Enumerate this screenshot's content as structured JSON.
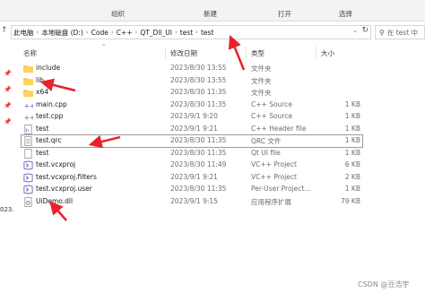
{
  "ribbon": {
    "groups": [
      "组织",
      "新建",
      "打开",
      "选择"
    ]
  },
  "address": {
    "path": [
      "此电脑",
      "本地磁盘 (D:)",
      "Code",
      "C++",
      "QT_Dll_UI",
      "test",
      "test"
    ],
    "search_placeholder": "在 test 中"
  },
  "navpane": {
    "label": "023."
  },
  "columns": {
    "name": "名称",
    "date": "修改日期",
    "type": "类型",
    "size": "大小"
  },
  "files": [
    {
      "name": "include",
      "date": "2023/8/30 13:55",
      "type": "文件夹",
      "size": "",
      "icon": "folder-icon",
      "selected": false
    },
    {
      "name": "lib",
      "date": "2023/8/30 13:55",
      "type": "文件夹",
      "size": "",
      "icon": "folder-icon",
      "selected": false
    },
    {
      "name": "x64",
      "date": "2023/8/30 11:35",
      "type": "文件夹",
      "size": "",
      "icon": "folder-icon",
      "selected": false
    },
    {
      "name": "main.cpp",
      "date": "2023/8/30 11:35",
      "type": "C++ Source",
      "size": "1 KB",
      "icon": "cpp-icon",
      "selected": false
    },
    {
      "name": "test.cpp",
      "date": "2023/9/1 9:20",
      "type": "C++ Source",
      "size": "1 KB",
      "icon": "cpp-icon",
      "selected": false
    },
    {
      "name": "test",
      "date": "2023/9/1 9:21",
      "type": "C++ Header file",
      "size": "1 KB",
      "icon": "header-icon",
      "selected": false
    },
    {
      "name": "test.qrc",
      "date": "2023/8/30 11:35",
      "type": "QRC 文件",
      "size": "1 KB",
      "icon": "qrc-icon",
      "selected": true
    },
    {
      "name": "test",
      "date": "2023/8/30 11:35",
      "type": "Qt UI file",
      "size": "1 KB",
      "icon": "ui-icon",
      "selected": false
    },
    {
      "name": "test.vcxproj",
      "date": "2023/8/30 11:49",
      "type": "VC++ Project",
      "size": "6 KB",
      "icon": "vcxproj-icon",
      "selected": false
    },
    {
      "name": "test.vcxproj.filters",
      "date": "2023/9/1 9:21",
      "type": "VC++ Project",
      "size": "2 KB",
      "icon": "vcxproj-icon",
      "selected": false
    },
    {
      "name": "test.vcxproj.user",
      "date": "2023/8/30 11:35",
      "type": "Per-User Project...",
      "size": "1 KB",
      "icon": "vcxproj-icon",
      "selected": false
    },
    {
      "name": "UiDemo.dll",
      "date": "2023/9/1 9:15",
      "type": "应用程序扩展",
      "size": "79 KB",
      "icon": "dll-icon",
      "selected": false
    }
  ],
  "watermark": "CSDN @豆浩宇",
  "colors": {
    "folder": "#f5c542",
    "arrow": "#e8222a",
    "selection_border": "#9a9a9a"
  }
}
